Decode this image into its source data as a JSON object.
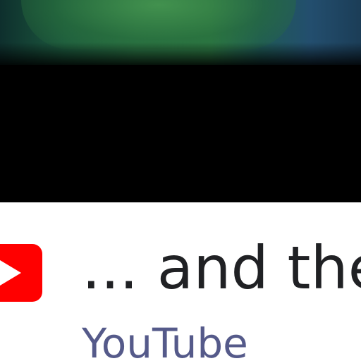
{
  "result": {
    "title": "... and the",
    "source": "YouTube",
    "source_icon": "youtube-play-icon",
    "colors": {
      "brand_red": "#ff0000",
      "title_text": "#202124",
      "source_text": "#555a8a"
    }
  }
}
